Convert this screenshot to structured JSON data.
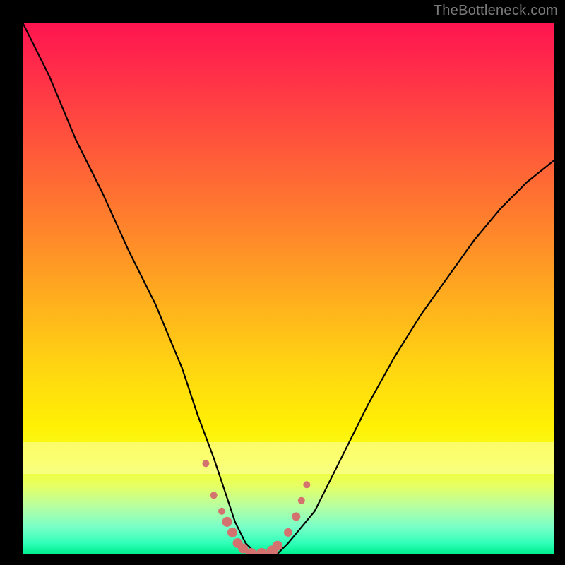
{
  "watermark": {
    "text": "TheBottleneck.com"
  },
  "chart_data": {
    "type": "line",
    "title": "",
    "xlabel": "",
    "ylabel": "",
    "xlim": [
      0,
      100
    ],
    "ylim": [
      0,
      100
    ],
    "grid": false,
    "series": [
      {
        "name": "bottleneck-curve",
        "x": [
          0,
          5,
          10,
          15,
          20,
          25,
          30,
          33,
          36,
          38,
          40,
          42,
          44,
          48,
          50,
          55,
          60,
          65,
          70,
          75,
          80,
          85,
          90,
          95,
          100
        ],
        "values": [
          100,
          90,
          78,
          68,
          57,
          47,
          35,
          26,
          18,
          12,
          6,
          2,
          0,
          0,
          2,
          8,
          18,
          28,
          37,
          45,
          52,
          59,
          65,
          70,
          74
        ]
      }
    ],
    "markers": {
      "name": "highlight-dots",
      "color": "#d4726f",
      "x": [
        34.5,
        36.0,
        37.5,
        38.5,
        39.5,
        40.5,
        41.5,
        43.0,
        45.0,
        47.0,
        48.0,
        50.0,
        51.5,
        52.5,
        53.5
      ],
      "values": [
        17.0,
        11.0,
        8.0,
        6.0,
        4.0,
        2.0,
        1.0,
        0.0,
        0.0,
        0.5,
        1.5,
        4.0,
        7.0,
        10.0,
        13.0
      ],
      "sizes": [
        10,
        10,
        10,
        14,
        14,
        14,
        14,
        16,
        16,
        16,
        14,
        12,
        12,
        10,
        10
      ]
    },
    "gradient_scale": {
      "top_color": "#ff1450",
      "bottom_color": "#00f090"
    }
  }
}
